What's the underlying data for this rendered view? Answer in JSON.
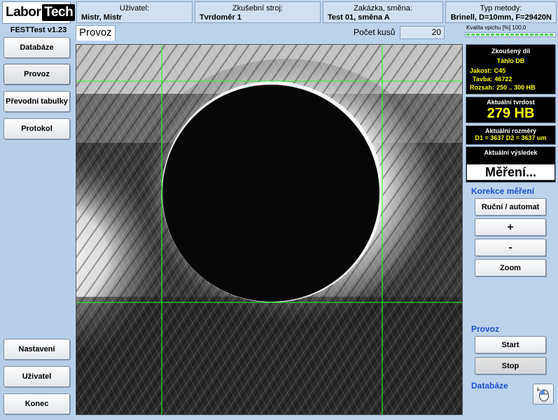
{
  "logo": {
    "part1": "Labor",
    "part2": "Tech"
  },
  "header": {
    "user": {
      "label": "Uživatel:",
      "value": "Mistr, Mistr"
    },
    "machine": {
      "label": "Zkušební stroj:",
      "value": "Tvrdoměr 1"
    },
    "order": {
      "label": "Zakázka, směna:",
      "value": "Test 01, směna A"
    },
    "method": {
      "label": "Typ metody:",
      "value": "Brinell, D=10mm, F=29420N"
    }
  },
  "version": "FESTTest v1.23",
  "sidebar": {
    "top": [
      "Databáze",
      "Provoz",
      "Převodní tabulky",
      "Protokol"
    ],
    "bottom": [
      "Nastavení",
      "Uživatel",
      "Konec"
    ],
    "active": "Provoz"
  },
  "tab": {
    "label": "Provoz"
  },
  "count": {
    "label": "Počet kusů",
    "value": "20"
  },
  "quality": {
    "label": "Kvalita vpichu [%] 100,0",
    "fraction": 1.0
  },
  "tested_part": {
    "title": "Zkoušený díl",
    "name": "Táhlo DB",
    "material_label": "Jakost:",
    "material": "C45",
    "heat_label": "Tavba:",
    "heat": "46722",
    "range_label": "Rozsah:",
    "range": "250  ..  300 HB"
  },
  "hardness": {
    "title": "Aktuální tvrdost",
    "value": "279 HB"
  },
  "dimensions": {
    "title": "Aktuální rozměry",
    "value": "D1 = 3637  D2 = 3637    um"
  },
  "result": {
    "title": "Aktuální výsledek",
    "value": "Měření..."
  },
  "correction": {
    "title": "Korekce měření",
    "buttons": [
      "Ruční / automat",
      "+",
      "-",
      "Zoom"
    ]
  },
  "operation": {
    "title": "Provoz",
    "start": "Start",
    "stop": "Stop"
  },
  "database": {
    "title": "Databáze"
  },
  "colors": {
    "accent": "#1e4fd6",
    "crosshair": "#22ff22",
    "highlight": "#ffff00"
  }
}
